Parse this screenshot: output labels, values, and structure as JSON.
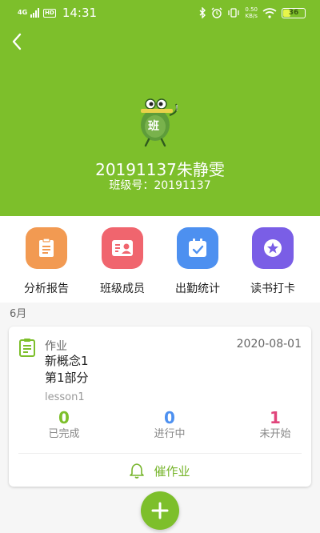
{
  "status_bar": {
    "signal_label": "4G",
    "hd_label": "HD",
    "time": "14:31",
    "net_speed": "0.50",
    "net_unit": "KB/s",
    "battery": "36",
    "battery_level": 0.36
  },
  "header": {
    "background_color": "#7dbf2b",
    "back_icon": "chevron-left-icon",
    "mascot_badge": "班",
    "class_name": "20191137朱静雯",
    "class_number": "班级号：20191137"
  },
  "features": [
    {
      "label": "分析报告",
      "icon": "document-icon",
      "color": "#f29a52"
    },
    {
      "label": "班级成员",
      "icon": "member-card-icon",
      "color": "#f0656e"
    },
    {
      "label": "出勤统计",
      "icon": "calendar-check-icon",
      "color": "#4d90f0"
    },
    {
      "label": "读书打卡",
      "icon": "star-badge-icon",
      "color": "#7a5ee6"
    }
  ],
  "month_label": "6月",
  "homework": {
    "type_label": "作业",
    "date": "2020-08-01",
    "title_line1": "新概念1",
    "title_line2": "第1部分",
    "lesson": "lesson1",
    "stats": [
      {
        "count": "0",
        "label": "已完成",
        "color": "#7dbf2b"
      },
      {
        "count": "0",
        "label": "进行中",
        "color": "#4d90f0"
      },
      {
        "count": "1",
        "label": "未开始",
        "color": "#e0457b"
      }
    ],
    "urge_label": "催作业"
  },
  "fab_icon": "plus-icon"
}
